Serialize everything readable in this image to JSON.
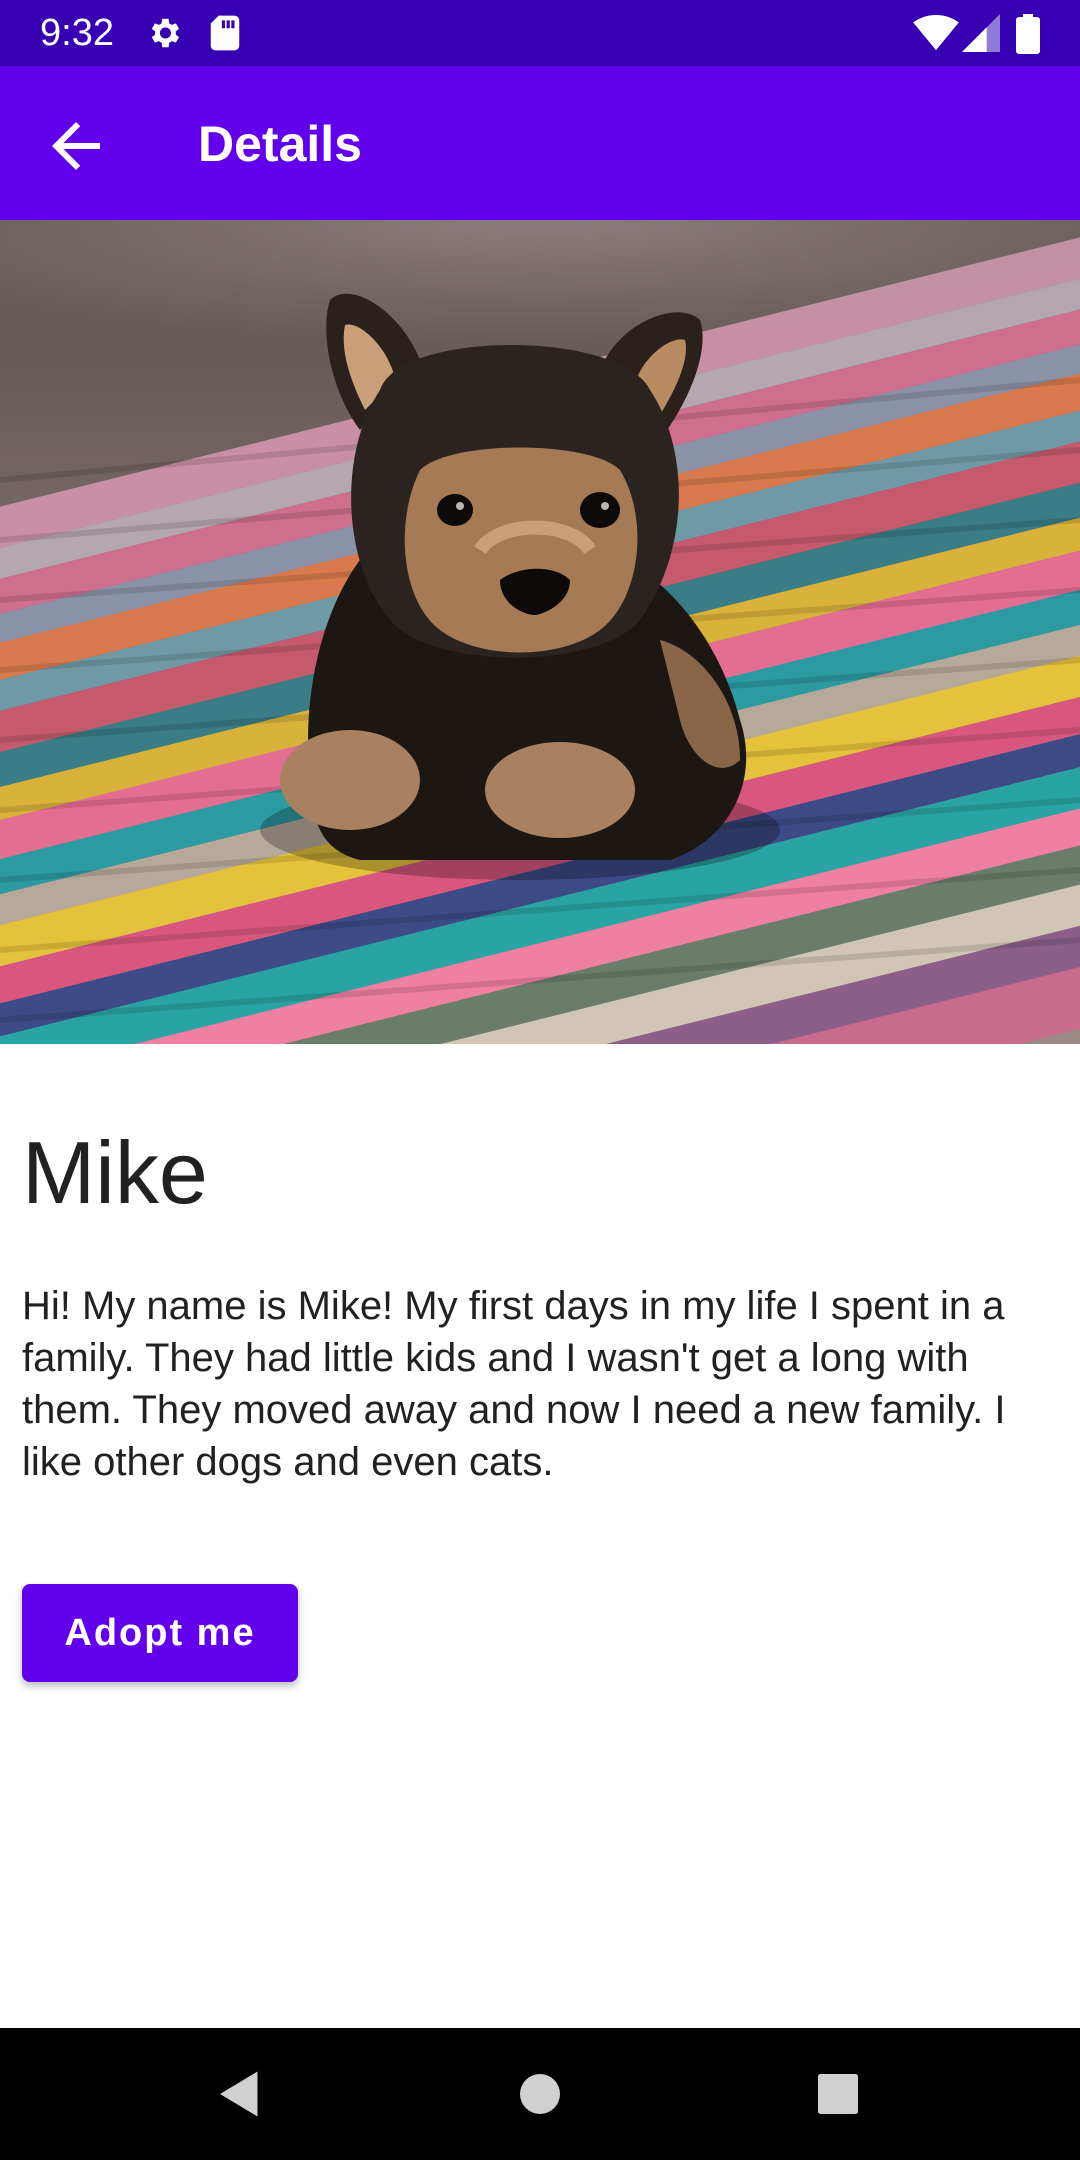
{
  "status_bar": {
    "time": "9:32",
    "left_icons": [
      "gear-icon",
      "sd-card-icon"
    ],
    "right_icons": [
      "wifi-icon",
      "signal-icon",
      "battery-icon"
    ]
  },
  "app_bar": {
    "title": "Details",
    "background": "#6200ee",
    "back_icon": "arrow-back-icon"
  },
  "hero": {
    "subject": "puppy on colorful striped rug"
  },
  "pet": {
    "name": "Mike",
    "description": "Hi! My name is Mike! My first days in my life I spent in a family. They had little kids and I wasn't get a long with them. They moved away and now I need a new family. I like other dogs and even cats."
  },
  "actions": {
    "adopt_label": "Adopt me",
    "accent": "#6200ee"
  },
  "nav_bar": {
    "items": [
      "back-triangle-icon",
      "home-circle-icon",
      "recents-square-icon"
    ]
  }
}
